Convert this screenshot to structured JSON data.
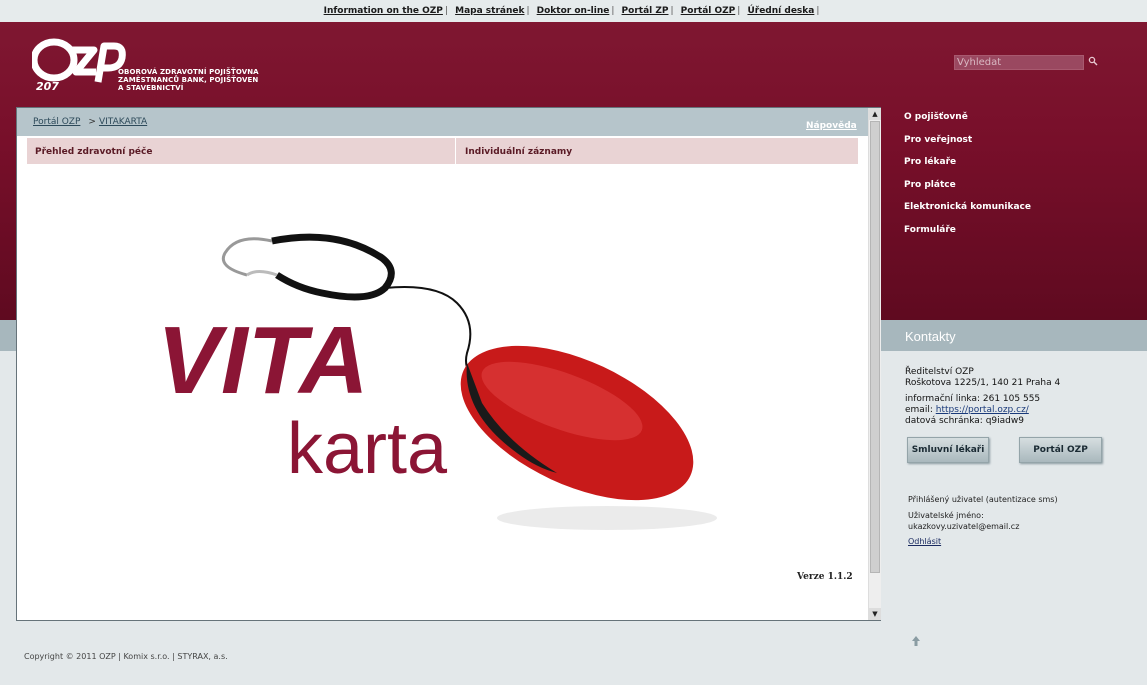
{
  "top_links": [
    "Information on the OZP",
    "Mapa stránek",
    "Doktor on-line",
    "Portál ZP",
    "Portál OZP",
    "Úřední deska"
  ],
  "logo": {
    "mark": "ozp",
    "number": "207",
    "line1": "OBOROVÁ ZDRAVOTNÍ POJIŠŤOVNA",
    "line2": "ZAMĚSTNANCŮ BANK, POJIŠŤOVEN",
    "line3": "A STAVEBNICTVÍ"
  },
  "search": {
    "placeholder": "Vyhledat"
  },
  "right_nav": [
    "O pojišťovně",
    "Pro veřejnost",
    "Pro lékaře",
    "Pro plátce",
    "Elektronická komunikace",
    "Formuláře"
  ],
  "breadcrumb": {
    "home": "Portál OZP",
    "arrow": ">",
    "current": "VITAKARTA"
  },
  "help_link": "Nápověda",
  "tabs": [
    "Přehled zdravotní péče",
    "Individuální záznamy"
  ],
  "banner": {
    "word1": "VITA",
    "word2": "karta"
  },
  "version": "Verze 1.1.2",
  "contacts": {
    "title": "Kontakty",
    "org": "Ředitelství OZP",
    "address": "Roškotova 1225/1, 140 21 Praha 4",
    "phone": "informační linka: 261 105 555",
    "email_label": "email:",
    "email_link": "https://portal.ozp.cz/",
    "databox": "datová schránka: q9iadw9",
    "btn_doctors": "Smluvní lékaři",
    "btn_portal": "Portál OZP"
  },
  "login": {
    "status": "Přihlášený uživatel (autentizace sms)",
    "user_label": "Uživatelské jméno:",
    "user": "ukazkovy.uzivatel@email.cz",
    "logout": "Odhlásit"
  },
  "footer": "Copyright © 2011 OZP  |  Komix s.r.o.  |  STYRAX, a.s.",
  "colors": {
    "brand": "#7f1731",
    "panel_head": "#b6c5cb",
    "tab_bg": "#e9d3d4",
    "vita": "#8b1535",
    "mouse": "#c81a1a"
  }
}
